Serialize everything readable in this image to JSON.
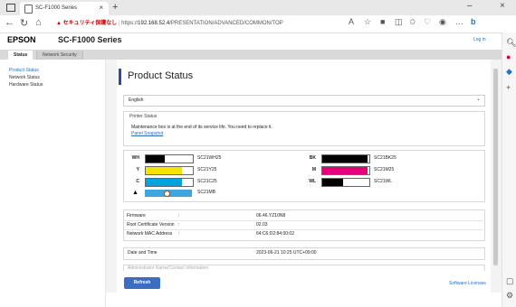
{
  "browser": {
    "tab_title": "SC-F1000 Series",
    "url_warning": "▲ セキュリティ保護なし",
    "url_sep": "|",
    "url_scheme": "https://",
    "url_host": "192.168.52.4",
    "url_path": "/PRESENTATION/ADVANCED/COMMON/TOP"
  },
  "header": {
    "brand": "EPSON",
    "model": "SC-F1000 Series",
    "logout": "Log in"
  },
  "page_tabs": [
    "Status",
    "Network Security"
  ],
  "left_nav": [
    "Product Status",
    "Network Status",
    "Hardware Status"
  ],
  "main": {
    "title": "Product Status",
    "language": "English"
  },
  "printer_status": {
    "legend": "Printer Status",
    "message": "Maintenance box is at the end of its service life. You need to replace it.",
    "link": "Panel Snapshot"
  },
  "inks": [
    {
      "code": "WH",
      "name": "SC21WH25",
      "color": "#000000",
      "level": 0.4
    },
    {
      "code": "BK",
      "name": "SC21BK25",
      "color": "#000000",
      "level": 0.97
    },
    {
      "code": "Y",
      "name": "SC21Y25",
      "color": "#f5e400",
      "level": 0.76
    },
    {
      "code": "M",
      "name": "SC21M25",
      "color": "#e6007e",
      "level": 0.97
    },
    {
      "code": "C",
      "name": "SC21C25",
      "color": "#00a3e0",
      "level": 0.76
    },
    {
      "code": "WL",
      "name": "SC21WL",
      "color": "#000000",
      "level": 0.44
    }
  ],
  "maintenance_box": {
    "name": "SC21MB",
    "color": "#3fa6dc"
  },
  "info": [
    {
      "label": "Firmware",
      "value": "06.46.YZ10N8"
    },
    {
      "label": "Root Certificate Version",
      "value": "02.03"
    },
    {
      "label": "Network MAC Address",
      "value": "64:C6:D2:84:00:02"
    }
  ],
  "date": {
    "label": "Date and Time",
    "value": "2023-06-21 10:25 UTC+09:00"
  },
  "cut_text": "Administrator Name/Contact Information",
  "buttons": {
    "refresh": "Refresh",
    "licenses": "Software Licenses"
  }
}
